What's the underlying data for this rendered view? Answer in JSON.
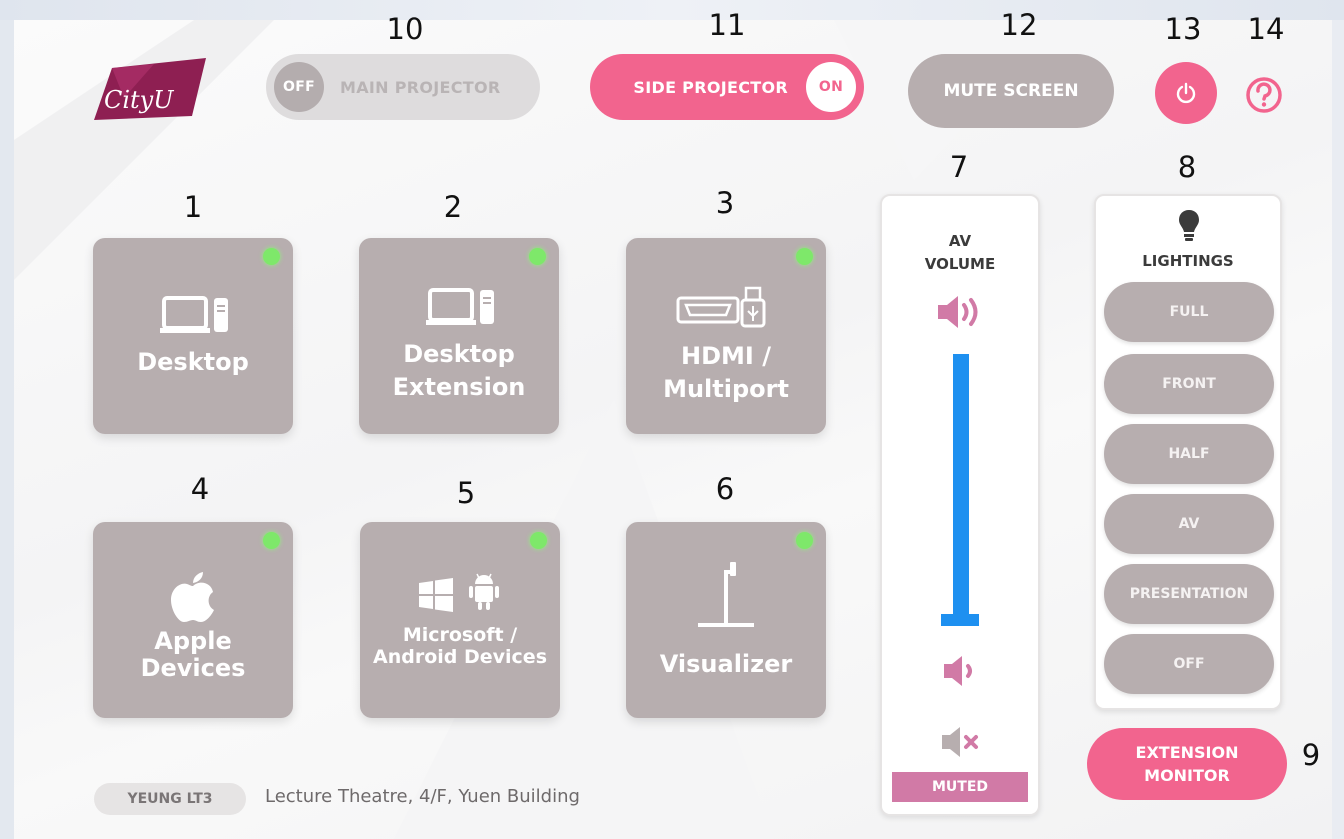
{
  "annotations": [
    "1",
    "2",
    "3",
    "4",
    "5",
    "6",
    "7",
    "8",
    "9",
    "10",
    "11",
    "12",
    "13",
    "14"
  ],
  "logo": {
    "text": "CityU"
  },
  "header": {
    "main_projector": {
      "state_label": "OFF",
      "label": "MAIN PROJECTOR",
      "on": false
    },
    "side_projector": {
      "state_label": "ON",
      "label": "SIDE PROJECTOR",
      "on": true
    },
    "mute_screen_label": "MUTE SCREEN",
    "power_icon": "power-icon",
    "help_icon": "help-icon"
  },
  "sources": [
    {
      "label": "Desktop",
      "icon": "desktop-icon",
      "active": true
    },
    {
      "label": "Desktop Extension",
      "icon": "desktop-icon",
      "active": true
    },
    {
      "label": "HDMI / Multiport",
      "icon": "hdmi-usb-icon",
      "active": true
    },
    {
      "label": "Apple Devices",
      "icon": "apple-icon",
      "active": true
    },
    {
      "label": "Microsoft / Android Devices",
      "icon": "windows-android-icon",
      "active": true
    },
    {
      "label": "Visualizer",
      "icon": "visualizer-icon",
      "active": true
    }
  ],
  "volume": {
    "title_line1": "AV",
    "title_line2": "VOLUME",
    "status": "MUTED"
  },
  "lighting": {
    "title": "LIGHTINGS",
    "options": [
      "FULL",
      "FRONT",
      "HALF",
      "AV",
      "PRESENTATION",
      "OFF"
    ]
  },
  "extension_monitor": {
    "line1": "EXTENSION",
    "line2": "MONITOR"
  },
  "room": {
    "code": "YEUNG LT3",
    "description": "Lecture Theatre, 4/F, Yuen Building"
  },
  "colors": {
    "accent_pink": "#f2648e",
    "tile_grey": "#b7aeaf",
    "volume_blue": "#1e90f0",
    "status_green": "#7ee86a",
    "muted_bar": "#d17aa6"
  }
}
